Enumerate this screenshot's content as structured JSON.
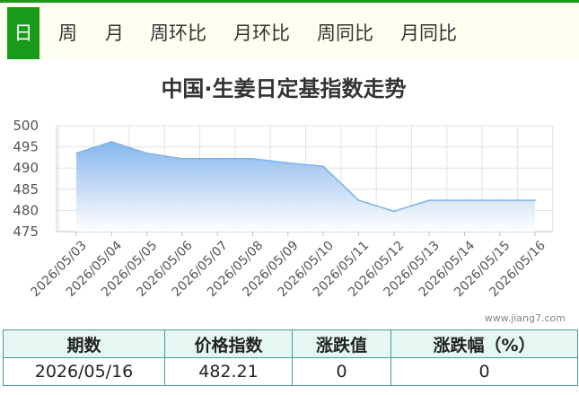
{
  "tabs": [
    {
      "label": "日",
      "active": true
    },
    {
      "label": "周",
      "active": false
    },
    {
      "label": "月",
      "active": false
    },
    {
      "label": "周环比",
      "active": false
    },
    {
      "label": "月环比",
      "active": false
    },
    {
      "label": "周同比",
      "active": false
    },
    {
      "label": "月同比",
      "active": false
    }
  ],
  "chart_data": {
    "type": "area",
    "title": "中国·生姜日定基指数走势",
    "categories": [
      "2026/05/03",
      "2026/05/04",
      "2026/05/05",
      "2026/05/06",
      "2026/05/07",
      "2026/05/08",
      "2026/05/09",
      "2026/05/10",
      "2026/05/11",
      "2026/05/12",
      "2026/05/13",
      "2026/05/14",
      "2026/05/15",
      "2026/05/16"
    ],
    "series": [
      {
        "values": [
          493.5,
          496.2,
          493.5,
          492.2,
          492.2,
          492.2,
          491.2,
          490.4,
          482.4,
          479.8,
          482.4,
          482.4,
          482.4,
          482.4
        ]
      }
    ],
    "ylim": [
      475,
      500
    ],
    "yticks": [
      475,
      480,
      485,
      490,
      495,
      500
    ],
    "grid": true,
    "line_color": "#7fb2e5",
    "fill_top_color": "#7fb2ec",
    "watermark": "www.jiang7.com"
  },
  "table": {
    "headers": [
      "期数",
      "价格指数",
      "涨跌值",
      "涨跌幅（%）"
    ],
    "rows": [
      [
        "2026/05/16",
        "482.21",
        "0",
        "0"
      ]
    ]
  },
  "colors": {
    "accent": "#1a9a1a",
    "tab_bg": "#fffff0",
    "table_border": "#4a9a9a",
    "table_header_bg": "#e6f7f3"
  }
}
